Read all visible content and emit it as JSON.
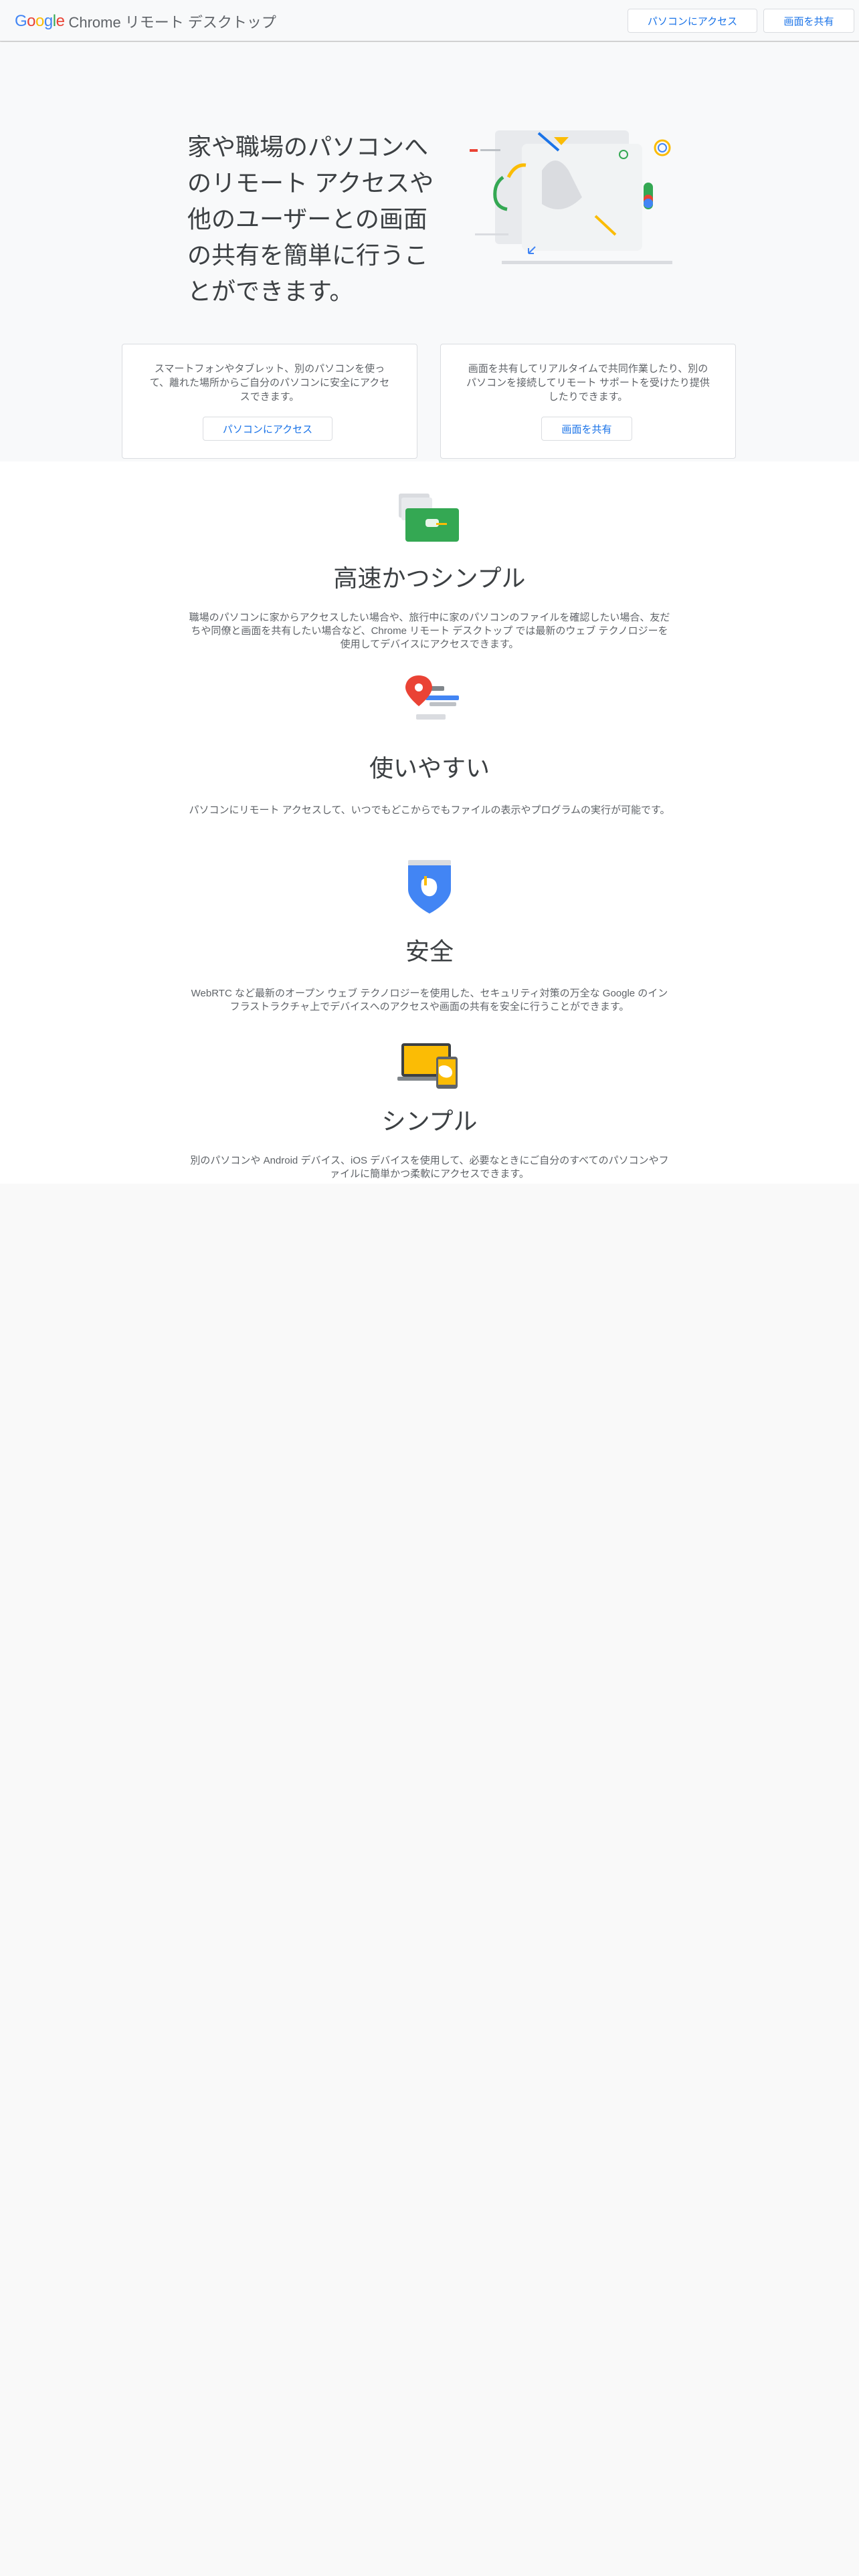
{
  "header": {
    "logo_letters": [
      "G",
      "o",
      "o",
      "g",
      "l",
      "e"
    ],
    "product_name": "Chrome リモート デスクトップ",
    "access_button": "パソコンにアクセス",
    "share_button": "画面を共有"
  },
  "hero": {
    "title": "家や職場のパソコンへのリモート アクセスや他のユーザーとの画面の共有を簡単に行うことができます。",
    "cards": [
      {
        "text": "スマートフォンやタブレット、別のパソコンを使って、離れた場所からご自分のパソコンに安全にアクセスできます。",
        "button": "パソコンにアクセス"
      },
      {
        "text": "画面を共有してリアルタイムで共同作業したり、別のパソコンを接続してリモート サポートを受けたり提供したりできます。",
        "button": "画面を共有"
      }
    ]
  },
  "features": [
    {
      "icon": "windows-remote-icon",
      "title": "高速かつシンプル",
      "description": "職場のパソコンに家からアクセスしたい場合や、旅行中に家のパソコンのファイルを確認したい場合、友だちや同僚と画面を共有したい場合など、Chrome リモート デスクトップ では最新のウェブ テクノロジーを使用してデバイスにアクセスできます。"
    },
    {
      "icon": "location-pin-icon",
      "title": "使いやすい",
      "description": "パソコンにリモート アクセスして、いつでもどこからでもファイルの表示やプログラムの実行が可能です。"
    },
    {
      "icon": "shield-icon",
      "title": "安全",
      "description": "WebRTC など最新のオープン ウェブ テクノロジーを使用した、セキュリティ対策の万全な Google のインフラストラクチャ上でデバイスへのアクセスや画面の共有を安全に行うことができます。"
    },
    {
      "icon": "devices-icon",
      "title": "シンプル",
      "description": "別のパソコンや Android デバイス、iOS デバイスを使用して、必要なときにご自分のすべてのパソコンやファイルに簡単かつ柔軟にアクセスできます。"
    }
  ],
  "colors": {
    "blue": "#4285f4",
    "red": "#ea4335",
    "yellow": "#fbbc05",
    "green": "#34a853",
    "link": "#1a73e8"
  }
}
